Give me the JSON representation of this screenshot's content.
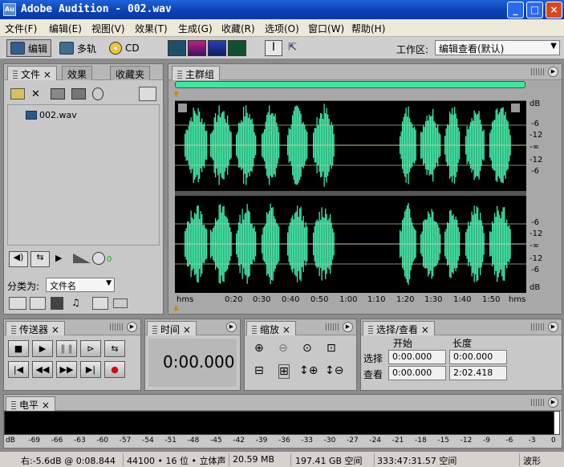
{
  "window": {
    "title": "Adobe Audition - 002.wav",
    "icon_text": "Au",
    "min": "_",
    "max": "□",
    "close": "×"
  },
  "menu": [
    "文件(F)",
    "编辑(E)",
    "视图(V)",
    "效果(T)",
    "生成(G)",
    "收藏(R)",
    "选项(O)",
    "窗口(W)",
    "帮助(H)"
  ],
  "toolbar": {
    "edit_label": "编辑",
    "multitrack_label": "多轨",
    "cd_label": "CD",
    "workspace_label": "工作区:",
    "workspace_value": "编辑查看(默认)"
  },
  "files_panel": {
    "tabs": [
      "文件",
      "效果",
      "收藏夹"
    ],
    "file_name": "002.wav",
    "sort_label": "分类为:",
    "sort_value": "文件名",
    "volume_value": "0"
  },
  "main_group": {
    "title": "主群组"
  },
  "timeline": {
    "ticks": [
      "hms",
      "0:20",
      "0:30",
      "0:40",
      "0:50",
      "1:00",
      "1:10",
      "1:20",
      "1:30",
      "1:40",
      "1:50",
      "hms"
    ]
  },
  "db_scale_top": [
    "dB",
    "-6",
    "-12",
    "-∞",
    "-12",
    "-6"
  ],
  "db_scale_bottom": [
    "-6",
    "-12",
    "-∞",
    "-12",
    "-6",
    "dB"
  ],
  "transport": {
    "title": "传送器"
  },
  "time_panel": {
    "title": "时间",
    "value": "0:00.000"
  },
  "zoom_panel": {
    "title": "缩放"
  },
  "selection": {
    "title": "选择/查看",
    "col_start": "开始",
    "col_length": "长度",
    "row_select": "选择",
    "row_view": "查看",
    "sel_start": "0:00.000",
    "sel_length": "0:00.000",
    "view_start": "0:00.000",
    "view_length": "2:02.418"
  },
  "levels": {
    "title": "电平",
    "ticks": [
      "dB",
      "-69",
      "-66",
      "-63",
      "-60",
      "-57",
      "-54",
      "-51",
      "-48",
      "-45",
      "-42",
      "-39",
      "-36",
      "-33",
      "-30",
      "-27",
      "-24",
      "-21",
      "-18",
      "-15",
      "-12",
      "-9",
      "-6",
      "-3",
      "0"
    ]
  },
  "status": {
    "right_channel": "右:-5.6dB @  0:08.844",
    "format": "44100 • 16 位 • 立体声",
    "size": "20.59 MB",
    "disk_free": "197.41 GB 空间",
    "time_free": "333:47:31.57 空间",
    "mode": "波形"
  },
  "colors": {
    "waveform": "#44e8a8",
    "waveform_bg": "#000000",
    "title_bar": "#0a3fb5"
  }
}
